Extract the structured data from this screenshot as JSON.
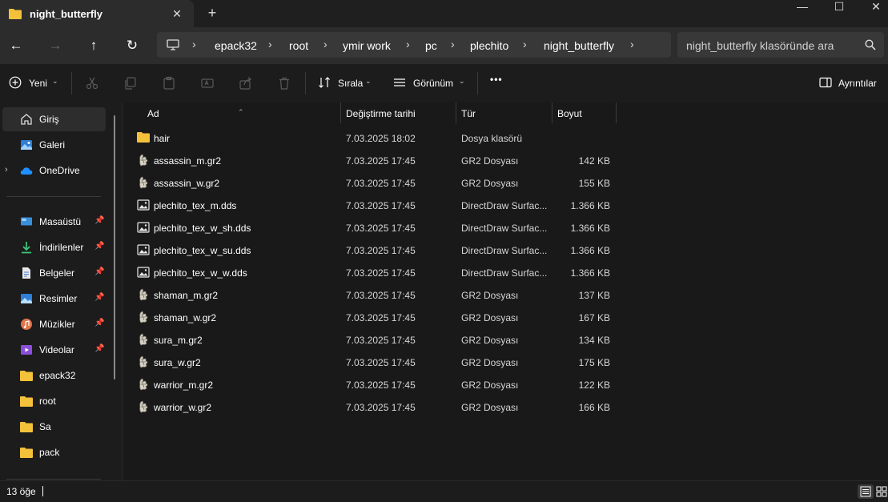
{
  "window": {
    "tab_title": "night_butterfly",
    "tab_close": "✕",
    "new_tab": "+",
    "minimize": "—",
    "maximize": "☐",
    "close": "✕"
  },
  "nav": {
    "back": "←",
    "forward": "→",
    "up": "↑",
    "refresh": "↻"
  },
  "breadcrumb": [
    "epack32",
    "root",
    "ymir work",
    "pc",
    "plechito",
    "night_butterfly"
  ],
  "search": {
    "placeholder": "night_butterfly klasöründe ara"
  },
  "commands": {
    "new_label": "Yeni",
    "sort_label": "Sırala",
    "view_label": "Görünüm",
    "more": "•••",
    "details_label": "Ayrıntılar"
  },
  "sidebar": {
    "top": [
      {
        "label": "Giriş",
        "icon": "home-icon"
      },
      {
        "label": "Galeri",
        "icon": "gallery-icon"
      },
      {
        "label": "OneDrive",
        "icon": "cloud-icon"
      }
    ],
    "pinned": [
      {
        "label": "Masaüstü",
        "icon": "desktop-icon"
      },
      {
        "label": "İndirilenler",
        "icon": "download-icon"
      },
      {
        "label": "Belgeler",
        "icon": "documents-icon"
      },
      {
        "label": "Resimler",
        "icon": "pictures-icon"
      },
      {
        "label": "Müzikler",
        "icon": "music-icon"
      },
      {
        "label": "Videolar",
        "icon": "videos-icon"
      }
    ],
    "folders": [
      {
        "label": "epack32"
      },
      {
        "label": "root"
      },
      {
        "label": "Sa"
      },
      {
        "label": "pack"
      }
    ]
  },
  "columns": {
    "name": "Ad",
    "modified": "Değiştirme tarihi",
    "type": "Tür",
    "size": "Boyut"
  },
  "files": [
    {
      "name": "hair",
      "modified": "7.03.2025 18:02",
      "type": "Dosya klasörü",
      "size": "",
      "icon": "folder-icon"
    },
    {
      "name": "assassin_m.gr2",
      "modified": "7.03.2025 17:45",
      "type": "GR2 Dosyası",
      "size": "142 KB",
      "icon": "gr2-file-icon"
    },
    {
      "name": "assassin_w.gr2",
      "modified": "7.03.2025 17:45",
      "type": "GR2 Dosyası",
      "size": "155 KB",
      "icon": "gr2-file-icon"
    },
    {
      "name": "plechito_tex_m.dds",
      "modified": "7.03.2025 17:45",
      "type": "DirectDraw Surfac...",
      "size": "1.366 KB",
      "icon": "image-file-icon"
    },
    {
      "name": "plechito_tex_w_sh.dds",
      "modified": "7.03.2025 17:45",
      "type": "DirectDraw Surfac...",
      "size": "1.366 KB",
      "icon": "image-file-icon"
    },
    {
      "name": "plechito_tex_w_su.dds",
      "modified": "7.03.2025 17:45",
      "type": "DirectDraw Surfac...",
      "size": "1.366 KB",
      "icon": "image-file-icon"
    },
    {
      "name": "plechito_tex_w_w.dds",
      "modified": "7.03.2025 17:45",
      "type": "DirectDraw Surfac...",
      "size": "1.366 KB",
      "icon": "image-file-icon"
    },
    {
      "name": "shaman_m.gr2",
      "modified": "7.03.2025 17:45",
      "type": "GR2 Dosyası",
      "size": "137 KB",
      "icon": "gr2-file-icon"
    },
    {
      "name": "shaman_w.gr2",
      "modified": "7.03.2025 17:45",
      "type": "GR2 Dosyası",
      "size": "167 KB",
      "icon": "gr2-file-icon"
    },
    {
      "name": "sura_m.gr2",
      "modified": "7.03.2025 17:45",
      "type": "GR2 Dosyası",
      "size": "134 KB",
      "icon": "gr2-file-icon"
    },
    {
      "name": "sura_w.gr2",
      "modified": "7.03.2025 17:45",
      "type": "GR2 Dosyası",
      "size": "175 KB",
      "icon": "gr2-file-icon"
    },
    {
      "name": "warrior_m.gr2",
      "modified": "7.03.2025 17:45",
      "type": "GR2 Dosyası",
      "size": "122 KB",
      "icon": "gr2-file-icon"
    },
    {
      "name": "warrior_w.gr2",
      "modified": "7.03.2025 17:45",
      "type": "GR2 Dosyası",
      "size": "166 KB",
      "icon": "gr2-file-icon"
    }
  ],
  "status": {
    "item_count": "13 öğe"
  },
  "colors": {
    "folder": "#f3c13a",
    "accent": "#4cc2ff",
    "background": "#191919"
  }
}
